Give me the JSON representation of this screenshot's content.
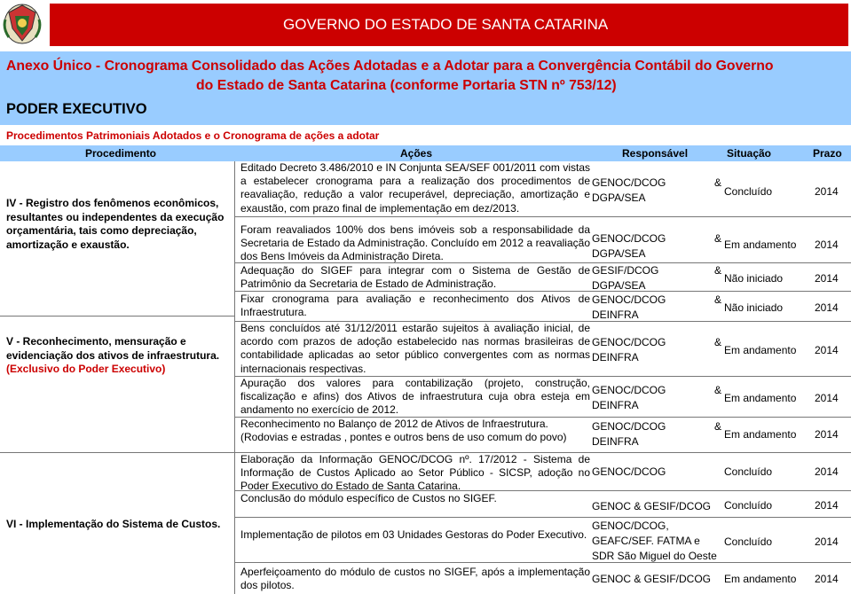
{
  "header": {
    "banner": "GOVERNO DO ESTADO DE SANTA CATARINA",
    "crest_icon": "santa-catarina-coat-of-arms"
  },
  "title": {
    "line1": "Anexo Único - Cronograma Consolidado das Ações Adotadas e a Adotar para a Convergência Contábil do Governo",
    "line2": "do Estado de Santa Catarina (conforme Portaria STN nº 753/12)"
  },
  "poder": "PODER EXECUTIVO",
  "subtitle": "Procedimentos Patrimoniais Adotados e o Cronograma de ações a adotar",
  "columns": {
    "procedimento": "Procedimento",
    "acoes": "Ações",
    "responsavel": "Responsável",
    "situacao": "Situação",
    "prazo": "Prazo"
  },
  "groups": [
    {
      "label": "IV - Registro dos fenômenos econômicos, resultantes ou independentes da execução orçamentária, tais como depreciação, amortização e exaustão."
    },
    {
      "label": "V - Reconhecimento, mensuração e evidenciação dos ativos de infraestrutura.",
      "note": "(Exclusivo do Poder Executivo)"
    },
    {
      "label": "VI - Implementação do Sistema de Custos."
    }
  ],
  "rows": [
    {
      "acao": "Editado Decreto 3.486/2010 e IN Conjunta SEA/SEF 001/2011 com vistas a estabelecer cronograma para a realização dos procedimentos de reavaliação, redução a valor recuperável, depreciação, amortização e exaustão, com prazo final de implementação em dez/2013.",
      "resp1": "GENOC/DCOG",
      "amp": "&",
      "resp2": "DGPA/SEA",
      "situacao": "Concluído",
      "prazo": "2014"
    },
    {
      "acao": "Foram reavaliados 100% dos bens imóveis sob a responsabilidade da Secretaria de Estado da Administração. Concluído em 2012 a reavaliação dos Bens Imóveis da Administração Direta.",
      "resp1": "GENOC/DCOG",
      "amp": "&",
      "resp2": "DGPA/SEA",
      "situacao": "Em andamento",
      "prazo": "2014"
    },
    {
      "acao": "Adequação do SIGEF para integrar com o Sistema de Gestão de Patrimônio da Secretaria de Estado de Administração.",
      "resp1": "GESIF/DCOG",
      "amp": "&",
      "resp2": "DGPA/SEA",
      "situacao": "Não iniciado",
      "prazo": "2014"
    },
    {
      "acao": "Fixar cronograma para avaliação e reconhecimento dos Ativos de Infraestrutura.",
      "resp1": "GENOC/DCOG",
      "amp": "&",
      "resp2": "DEINFRA",
      "situacao": "Não iniciado",
      "prazo": "2014"
    },
    {
      "acao": "Bens concluídos até 31/12/2011 estarão sujeitos à avaliação inicial, de acordo com prazos de adoção estabelecido nas normas brasileiras de contabilidade aplicadas ao setor público convergentes com as normas internacionais respectivas.",
      "resp1": "GENOC/DCOG",
      "amp": "&",
      "resp2": "DEINFRA",
      "situacao": "Em andamento",
      "prazo": "2014"
    },
    {
      "acao": "Apuração dos valores para contabilização (projeto, construção, fiscalização e afins) dos Ativos de infraestrutura cuja obra esteja em andamento no exercício de 2012.",
      "resp1": "GENOC/DCOG",
      "amp": "&",
      "resp2": "DEINFRA",
      "situacao": "Em andamento",
      "prazo": "2014"
    },
    {
      "acao": "Reconhecimento no Balanço de 2012 de Ativos de Infraestrutura.",
      "acao_extra": "(Rodovias e estradas , pontes e outros bens de uso comum do povo)",
      "resp1": "GENOC/DCOG",
      "amp": "&",
      "resp2": "DEINFRA",
      "situacao": "Em andamento",
      "prazo": "2014"
    },
    {
      "acao": "Elaboração da Informação GENOC/DCOG nº. 17/2012 - Sistema de Informação de Custos Aplicado ao Setor Público - SICSP, adoção no Poder Executivo do Estado de Santa Catarina.",
      "resp1": "GENOC/DCOG",
      "situacao": "Concluído",
      "prazo": "2014"
    },
    {
      "acao": "Conclusão do módulo específico de Custos no SIGEF.",
      "resp1": "GENOC & GESIF/DCOG",
      "situacao": "Concluído",
      "prazo": "2014"
    },
    {
      "acao": "Implementação de pilotos em 03 Unidades Gestoras do Poder Executivo.",
      "resp1": "GENOC/DCOG,",
      "resp2": "GEAFC/SEF. FATMA e",
      "resp3": "SDR São Miguel do Oeste",
      "situacao": "Concluído",
      "prazo": "2014"
    },
    {
      "acao": "Aperfeiçoamento do módulo de custos no SIGEF, após a implementação dos pilotos.",
      "resp1": "GENOC & GESIF/DCOG",
      "situacao": "Em andamento",
      "prazo": "2014"
    }
  ]
}
